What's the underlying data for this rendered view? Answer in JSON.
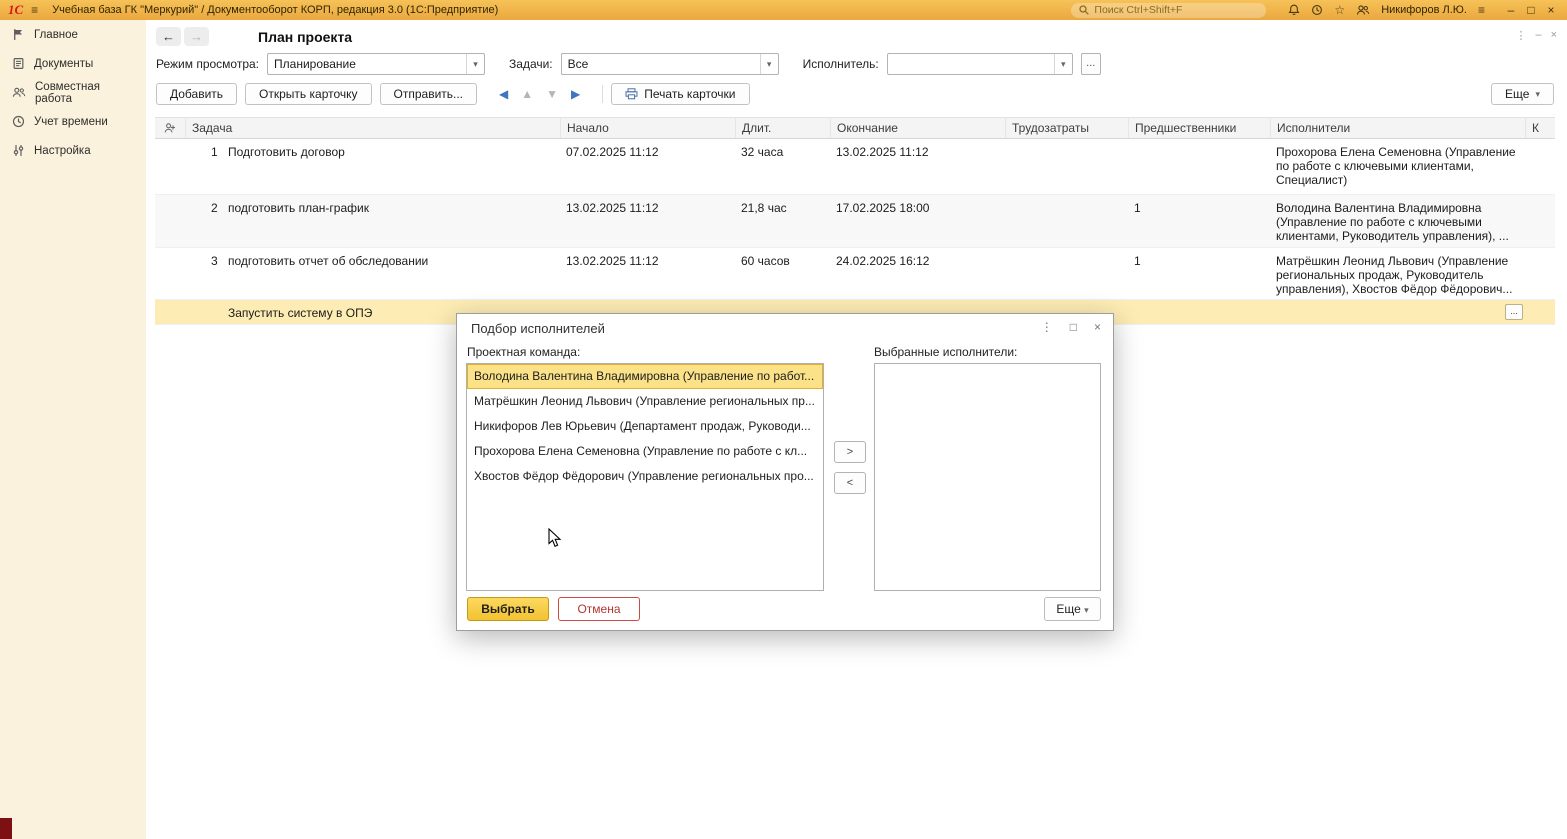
{
  "icons": {
    "menu": "≡",
    "star": "☆",
    "minimize": "–",
    "maximize": "□",
    "close": "×",
    "kebab": "⋮",
    "dropdown": "▾",
    "ellipsis": "...",
    "back": "←",
    "forward": "→",
    "arrow_left": "◀",
    "arrow_up": "▲",
    "arrow_down": "▼",
    "arrow_right": "▶",
    "move_right": ">",
    "move_left": "<"
  },
  "colors": {
    "titlebar": "#f0b54a",
    "sidebar": "#fbf2dd",
    "row_selection": "#fdecb3",
    "list_selection": "#fbe187",
    "accent_blue": "#3f76bf",
    "select_button": "#f6c937",
    "cancel_red": "#cd4a42",
    "logo_red": "#da1420"
  },
  "titlebar": {
    "logo": "1С",
    "title": "Учебная база ГК \"Меркурий\" / Документооборот КОРП, редакция 3.0  (1С:Предприятие)",
    "search_placeholder": "Поиск Ctrl+Shift+F",
    "user": "Никифоров Л.Ю."
  },
  "sidebar": {
    "items": [
      {
        "label": "Главное"
      },
      {
        "label": "Документы"
      },
      {
        "label": "Совместная работа"
      },
      {
        "label": "Учет времени"
      },
      {
        "label": "Настройка"
      }
    ]
  },
  "page": {
    "title": "План проекта",
    "filters": {
      "view_mode_label": "Режим просмотра:",
      "view_mode_value": "Планирование",
      "tasks_label": "Задачи:",
      "tasks_value": "Все",
      "executor_label": "Исполнитель:",
      "executor_value": ""
    },
    "toolbar": {
      "add": "Добавить",
      "open_card": "Открыть карточку",
      "send": "Отправить...",
      "print": "Печать карточки",
      "more": "Еще"
    },
    "table": {
      "headers": [
        "Задача",
        "Начало",
        "Длит.",
        "Окончание",
        "Трудозатраты",
        "Предшественники",
        "Исполнители",
        "К"
      ],
      "rows": [
        {
          "num": "1",
          "task": "Подготовить договор",
          "start": "07.02.2025 11:12",
          "duration": "32 часа",
          "end": "13.02.2025 11:12",
          "labor": "",
          "predecessors": "",
          "executors": "Прохорова Елена Семеновна (Управление по работе с ключевыми клиентами, Специалист)"
        },
        {
          "num": "2",
          "task": "подготовить план-график",
          "start": "13.02.2025 11:12",
          "duration": "21,8 час",
          "end": "17.02.2025 18:00",
          "labor": "",
          "predecessors": "1",
          "executors": "Володина Валентина Владимировна (Управление по работе с ключевыми клиентами, Руководитель управления), ..."
        },
        {
          "num": "3",
          "task": "подготовить отчет об обследовании",
          "start": "13.02.2025 11:12",
          "duration": "60 часов",
          "end": "24.02.2025 16:12",
          "labor": "",
          "predecessors": "1",
          "executors": "Матрёшкин Леонид Львович (Управление региональных продаж, Руководитель управления), Хвостов Фёдор Фёдорович..."
        },
        {
          "num": "",
          "task": "Запустить систему в ОПЭ",
          "start": "",
          "duration": "",
          "end": "",
          "labor": "",
          "predecessors": "",
          "executors": ""
        }
      ]
    }
  },
  "dialog": {
    "title": "Подбор исполнителей",
    "team_label": "Проектная команда:",
    "team": [
      "Володина Валентина Владимировна (Управление по работ...",
      "Матрёшкин Леонид Львович (Управление региональных пр...",
      "Никифоров Лев Юрьевич (Департамент продаж, Руководи...",
      "Прохорова Елена Семеновна (Управление по работе с кл...",
      "Хвостов Фёдор Фёдорович (Управление региональных про..."
    ],
    "selected_label": "Выбранные исполнители:",
    "select_button": "Выбрать",
    "cancel_button": "Отмена",
    "more_button": "Еще"
  }
}
